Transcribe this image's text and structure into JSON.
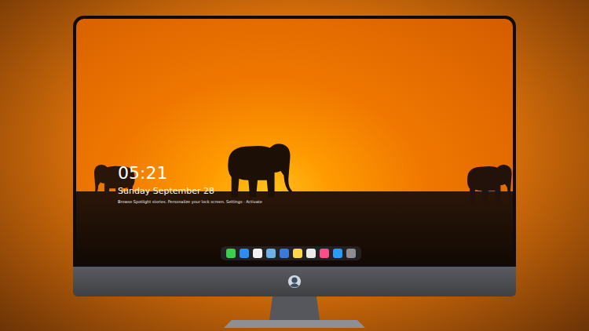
{
  "lock_screen": {
    "time": "05:21",
    "date": "Sunday September 28",
    "caption": "Browse Spotlight stories. Personalize your lock screen. Settings · Activate"
  }
}
